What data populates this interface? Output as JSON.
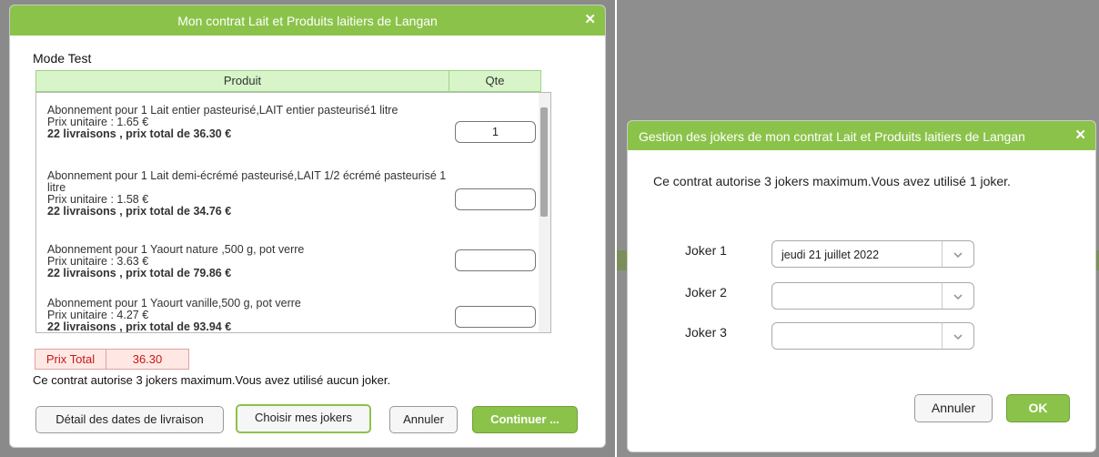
{
  "main_dialog": {
    "title": "Mon contrat Lait et Produits laitiers de Langan",
    "mode": "Mode Test",
    "table": {
      "col_product": "Produit",
      "col_qty": "Qte"
    },
    "items": [
      {
        "desc": "Abonnement pour 1 Lait entier pasteurisé,LAIT entier pasteurisé1 litre",
        "unit_price": "Prix unitaire : 1.65 €",
        "total": "22 livraisons , prix total de 36.30 €",
        "qty": "1"
      },
      {
        "desc": "Abonnement pour 1 Lait demi-écrémé pasteurisé,LAIT 1/2 écrémé pasteurisé 1 litre",
        "unit_price": "Prix unitaire : 1.58 €",
        "total": "22 livraisons , prix total de 34.76 €",
        "qty": ""
      },
      {
        "desc": "Abonnement pour 1 Yaourt nature ,500 g, pot verre",
        "unit_price": "Prix unitaire : 3.63 €",
        "total": "22 livraisons , prix total de 79.86 €",
        "qty": ""
      },
      {
        "desc": "Abonnement pour 1 Yaourt vanille,500 g, pot verre",
        "unit_price": "Prix unitaire : 4.27 €",
        "total": "22 livraisons , prix total de 93.94 €",
        "qty": ""
      }
    ],
    "prix_total_label": "Prix Total",
    "prix_total_value": "36.30",
    "jokers_info": "Ce contrat autorise 3 jokers maximum.Vous avez utilisé aucun joker.",
    "buttons": {
      "details": "Détail des dates de livraison",
      "choose_jokers": "Choisir mes jokers",
      "cancel": "Annuler",
      "continue": "Continuer ..."
    }
  },
  "joker_dialog": {
    "title": "Gestion des jokers de mon contrat Lait et Produits laitiers de Langan",
    "message": "Ce contrat autorise 3 jokers maximum.Vous avez utilisé 1 joker.",
    "jokers": [
      {
        "label": "Joker 1",
        "value": "jeudi 21 juillet 2022"
      },
      {
        "label": "Joker 2",
        "value": ""
      },
      {
        "label": "Joker 3",
        "value": ""
      }
    ],
    "buttons": {
      "cancel": "Annuler",
      "ok": "OK"
    }
  },
  "colors": {
    "accent_green": "#8bc34a",
    "header_green": "#d7f5c8",
    "total_red": "#c31818"
  }
}
